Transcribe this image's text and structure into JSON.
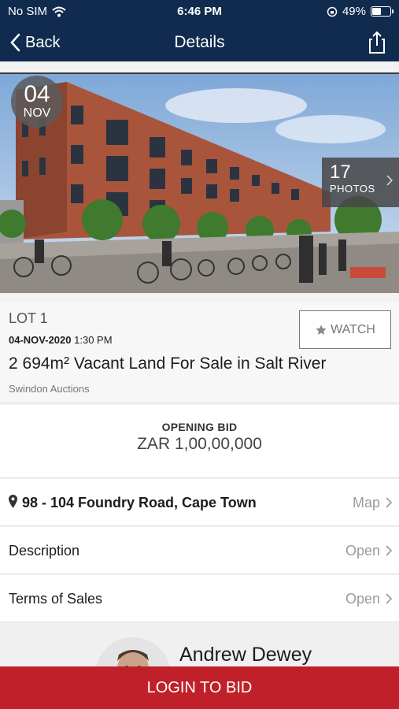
{
  "status_bar": {
    "carrier": "No SIM",
    "time": "6:46 PM",
    "battery_pct": "49%",
    "battery_level": 0.49
  },
  "nav": {
    "back_label": "Back",
    "title": "Details"
  },
  "hero": {
    "date_day": "04",
    "date_month": "NOV",
    "photo_count": "17",
    "photos_label": "PHOTOS"
  },
  "lot": {
    "label": "LOT 1",
    "date": "04-NOV-2020",
    "time": "1:30 PM",
    "title": "2 694m² Vacant Land For Sale in Salt River",
    "auctioneer": "Swindon Auctions",
    "watch_label": "WATCH"
  },
  "bid": {
    "label": "OPENING BID",
    "value": "ZAR 1,00,00,000"
  },
  "rows": [
    {
      "label": "98 - 104 Foundry Road, Cape Town",
      "action": "Map"
    },
    {
      "label": "Description",
      "action": "Open"
    },
    {
      "label": "Terms of Sales",
      "action": "Open"
    }
  ],
  "agent": {
    "name": "Andrew Dewey"
  },
  "login": {
    "label": "LOGIN TO BID"
  },
  "colors": {
    "nav_bg": "#102b4e",
    "login_bg": "#c0202a",
    "muted_text": "#9a9a9a"
  }
}
